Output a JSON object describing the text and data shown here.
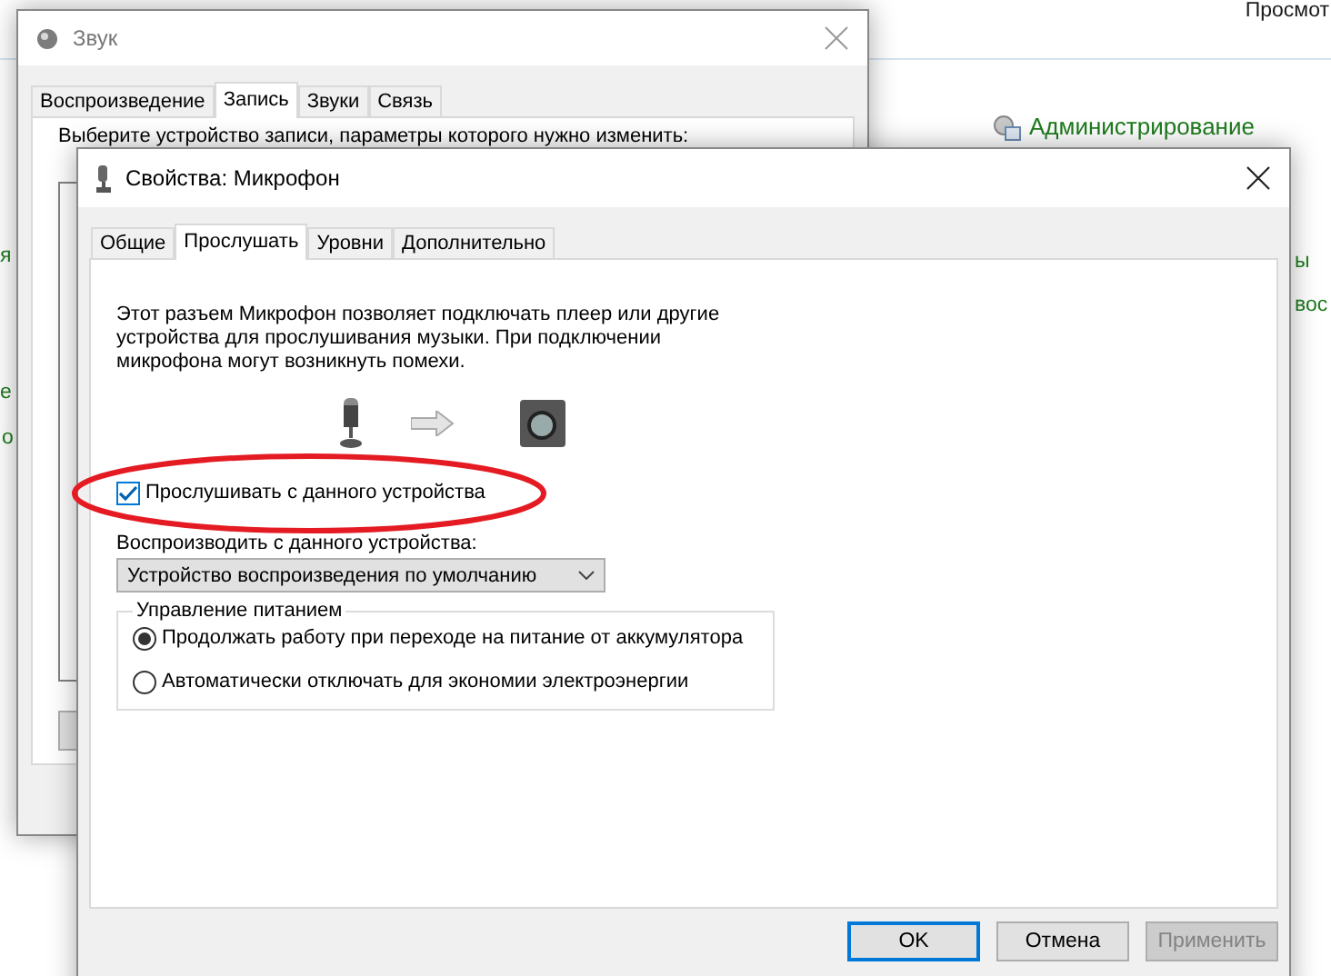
{
  "background": {
    "view_label": "Просмот",
    "admin_link": "Администрирование",
    "left_fragments": [
      "я",
      "е",
      "о"
    ],
    "right_fragments": [
      "ы",
      "вос"
    ]
  },
  "sound_window": {
    "title": "Звук",
    "tabs": [
      {
        "label": "Воспроизведение",
        "selected": false
      },
      {
        "label": "Запись",
        "selected": true
      },
      {
        "label": "Звуки",
        "selected": false
      },
      {
        "label": "Связь",
        "selected": false
      }
    ],
    "prompt": "Выберите устройство записи, параметры которого нужно изменить:"
  },
  "properties_dialog": {
    "title": "Свойства: Микрофон",
    "tabs": [
      {
        "label": "Общие",
        "selected": false
      },
      {
        "label": "Прослушать",
        "selected": true
      },
      {
        "label": "Уровни",
        "selected": false
      },
      {
        "label": "Дополнительно",
        "selected": false
      }
    ],
    "description": "Этот разъем Микрофон позволяет подключать плеер или другие устройства для прослушивания музыки. При подключении микрофона могут возникнуть помехи.",
    "listen_checkbox": {
      "label": "Прослушивать с данного устройства",
      "checked": true,
      "highlighted": true
    },
    "playback_label": "Воспроизводить с данного устройства:",
    "playback_device": "Устройство воспроизведения по умолчанию",
    "power_group": {
      "title": "Управление питанием",
      "options": [
        {
          "label": "Продолжать работу при переходе на питание от аккумулятора",
          "selected": true
        },
        {
          "label": "Автоматически отключать для экономии электроэнергии",
          "selected": false
        }
      ]
    },
    "buttons": [
      {
        "label": "OK",
        "default": true,
        "disabled": false
      },
      {
        "label": "Отмена",
        "default": false,
        "disabled": false
      },
      {
        "label": "Применить",
        "default": false,
        "disabled": true
      }
    ]
  }
}
